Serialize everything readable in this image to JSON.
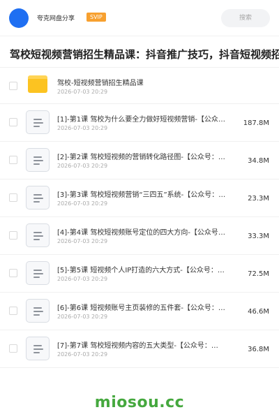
{
  "header": {
    "username": "夸克网盘分享",
    "vip_badge": "SVIP",
    "search_placeholder": "搜索"
  },
  "page_title": "驾校短视频营销招生精品课：抖音推广技巧，抖音短视频招",
  "folder": {
    "name": "驾校-短视频营销招生精品课",
    "date": "2026-07-03 20:29"
  },
  "files": [
    {
      "name": "[1]-第1课 驾校为什么要全力做好短视频营销-【公众号：…",
      "date": "2026-07-03 20:29",
      "size": "187.8M"
    },
    {
      "name": "[2]-第2课 驾校短视频的营销转化路径图-【公众号：…",
      "date": "2026-07-03 20:29",
      "size": "34.8M"
    },
    {
      "name": "[3]-第3课 驾校短视频营销“三四五”系统-【公众号：…",
      "date": "2026-07-03 20:29",
      "size": "23.3M"
    },
    {
      "name": "[4]-第4课 驾校短视频账号定位的四大方向-【公众号：…",
      "date": "2026-07-03 20:29",
      "size": "33.3M"
    },
    {
      "name": "[5]-第5课 短视频个人IP打造的六大方式-【公众号：…",
      "date": "2026-07-03 20:29",
      "size": "72.5M"
    },
    {
      "name": "[6]-第6课 短视频账号主页装修的五件套-【公众号：…",
      "date": "2026-07-03 20:29",
      "size": "46.6M"
    },
    {
      "name": "[7]-第7课 驾校短视频内容的五大类型-【公众号：…",
      "date": "2026-07-03 20:29",
      "size": "36.8M"
    }
  ],
  "watermark": "miosou.cc",
  "colors": {
    "accent_blue": "#1f6ff2",
    "vip_orange": "#f7a02f",
    "folder_yellow": "#fcc321",
    "watermark_green": "#45a83e"
  }
}
